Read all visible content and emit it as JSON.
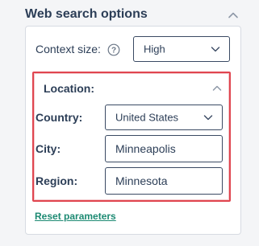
{
  "section": {
    "title": "Web search options"
  },
  "context": {
    "label": "Context size:",
    "value": "High"
  },
  "location": {
    "title": "Location:",
    "country_label": "Country:",
    "country_value": "United States",
    "city_label": "City:",
    "city_value": "Minneapolis",
    "region_label": "Region:",
    "region_value": "Minnesota"
  },
  "reset_label": "Reset parameters",
  "colors": {
    "highlight_border": "#e0454f",
    "link": "#1d8a73",
    "text": "#2c3e57"
  },
  "icons": {
    "section_collapse": "chevron-up-icon",
    "help": "question-circle-icon",
    "dropdown": "chevron-down-icon",
    "location_collapse": "chevron-up-icon"
  }
}
